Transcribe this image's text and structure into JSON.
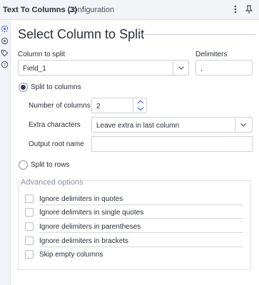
{
  "titlebar": {
    "title": "Text To Columns (3)",
    "subtitle": "- Configuration",
    "menu_icon": "more-vertical-icon",
    "pin_icon": "pin-icon"
  },
  "sidebar": {
    "icons": [
      "gear-icon",
      "settings-circle-icon",
      "tag-icon",
      "help-icon"
    ]
  },
  "main": {
    "heading": "Select Column to Split",
    "column_label": "Column to split",
    "column_value": "Field_1",
    "delimiters_label": "Delimiters",
    "delimiters_value": ",",
    "split_columns_label": "Split to columns",
    "split_columns_selected": true,
    "num_columns_label": "Number of columns",
    "num_columns_value": "2",
    "extra_chars_label": "Extra characters",
    "extra_chars_value": "Leave extra in last column",
    "output_root_label": "Output root name",
    "output_root_value": "",
    "split_rows_label": "Split to rows",
    "split_rows_selected": false
  },
  "advanced": {
    "title": "Advanced options",
    "options": [
      {
        "label": "Ignore delimiters in quotes",
        "checked": false
      },
      {
        "label": "Ignore delimiters in single quotes",
        "checked": false
      },
      {
        "label": "Ignore delimiters in parentheses",
        "checked": false
      },
      {
        "label": "Ignore delimiters in brackets",
        "checked": false
      },
      {
        "label": "Skip empty columns",
        "checked": false
      }
    ]
  },
  "colors": {
    "accent": "#3b5bdb",
    "border": "#cfd2d9",
    "muted": "#8a8fa6"
  }
}
